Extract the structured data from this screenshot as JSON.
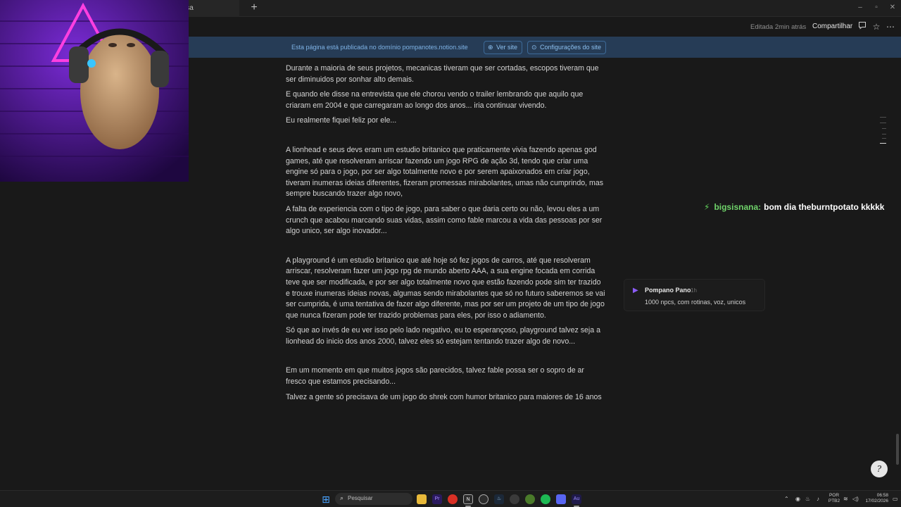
{
  "tab": {
    "title": "isa",
    "new_tab": "+"
  },
  "window_controls": {
    "minimize": "–",
    "maximize": "▫",
    "close": "✕"
  },
  "topbar": {
    "edited": "Editada 2min atrás",
    "share": "Compartilhar"
  },
  "banner": {
    "text": "Esta página está publicada no domínio pompanotes.notion.site",
    "view_site": "Ver site",
    "site_settings": "Configurações do site"
  },
  "chat": {
    "username": "bigsisnana:",
    "message": "bom dia theburntpotato kkkkk"
  },
  "paragraphs": [
    "Durante a maioria de seus projetos, mecanicas tiveram que ser cortadas, escopos tiveram que ser diminuidos por sonhar alto demais.",
    "E quando ele disse na entrevista que ele chorou vendo o trailer lembrando que aquilo que criaram em 2004 e que carregaram ao longo dos anos... iria continuar vivendo.",
    "Eu realmente fiquei feliz por ele...",
    "A lionhead e seus devs eram um estudio britanico que praticamente vivia fazendo apenas god games, até que resolveram arriscar fazendo um jogo RPG de ação 3d, tendo que criar uma engine só para o jogo, por ser algo totalmente novo e por serem apaixonados em criar jogo, tiveram inumeras ideias diferentes, fizeram promessas mirabolantes, umas não cumprindo, mas sempre buscando trazer algo novo,",
    "A falta de experiencia com o tipo de jogo, para saber o que daria certo ou não,  levou eles a um crunch que acabou marcando suas vidas, assim como fable marcou a vida das pessoas por ser algo unico, ser algo inovador...",
    "A playground é um estudio britanico que até hoje só fez jogos de carros, até que resolveram arriscar, resolveram fazer um jogo rpg de mundo aberto AAA, a sua engine focada em corrida teve que ser modificada, e por ser algo totalmente novo que estão fazendo pode sim ter trazido e trouxe inumeras ideias novas, algumas sendo mirabolantes que só no futuro saberemos se vai ser cumprida, é uma tentativa de fazer algo diferente, mas por ser um projeto de um tipo de jogo que nunca fizeram pode ter trazido problemas para eles, por isso o adiamento.",
    "Só que ao invés de eu ver isso pelo lado negativo, eu to esperançoso, playground talvez seja a lionhead do inicio dos anos 2000,  talvez eles só estejam tentando trazer algo de novo...",
    "Em um momento em que muitos jogos são parecidos, talvez fable possa ser o sopro de ar fresco que estamos precisando...",
    "Talvez a gente só precisava de um jogo do shrek com humor britanico para maiores de 16 anos"
  ],
  "comment": {
    "author": "Pompano Pano",
    "time": "1h",
    "text": "1000 npcs, com rotinas, voz, unicos"
  },
  "help_button": "?",
  "taskbar": {
    "search_placeholder": "Pesquisar",
    "lang_line1": "POR",
    "lang_line2": "PTB2",
    "time": "06:58",
    "date": "17/02/2026"
  }
}
